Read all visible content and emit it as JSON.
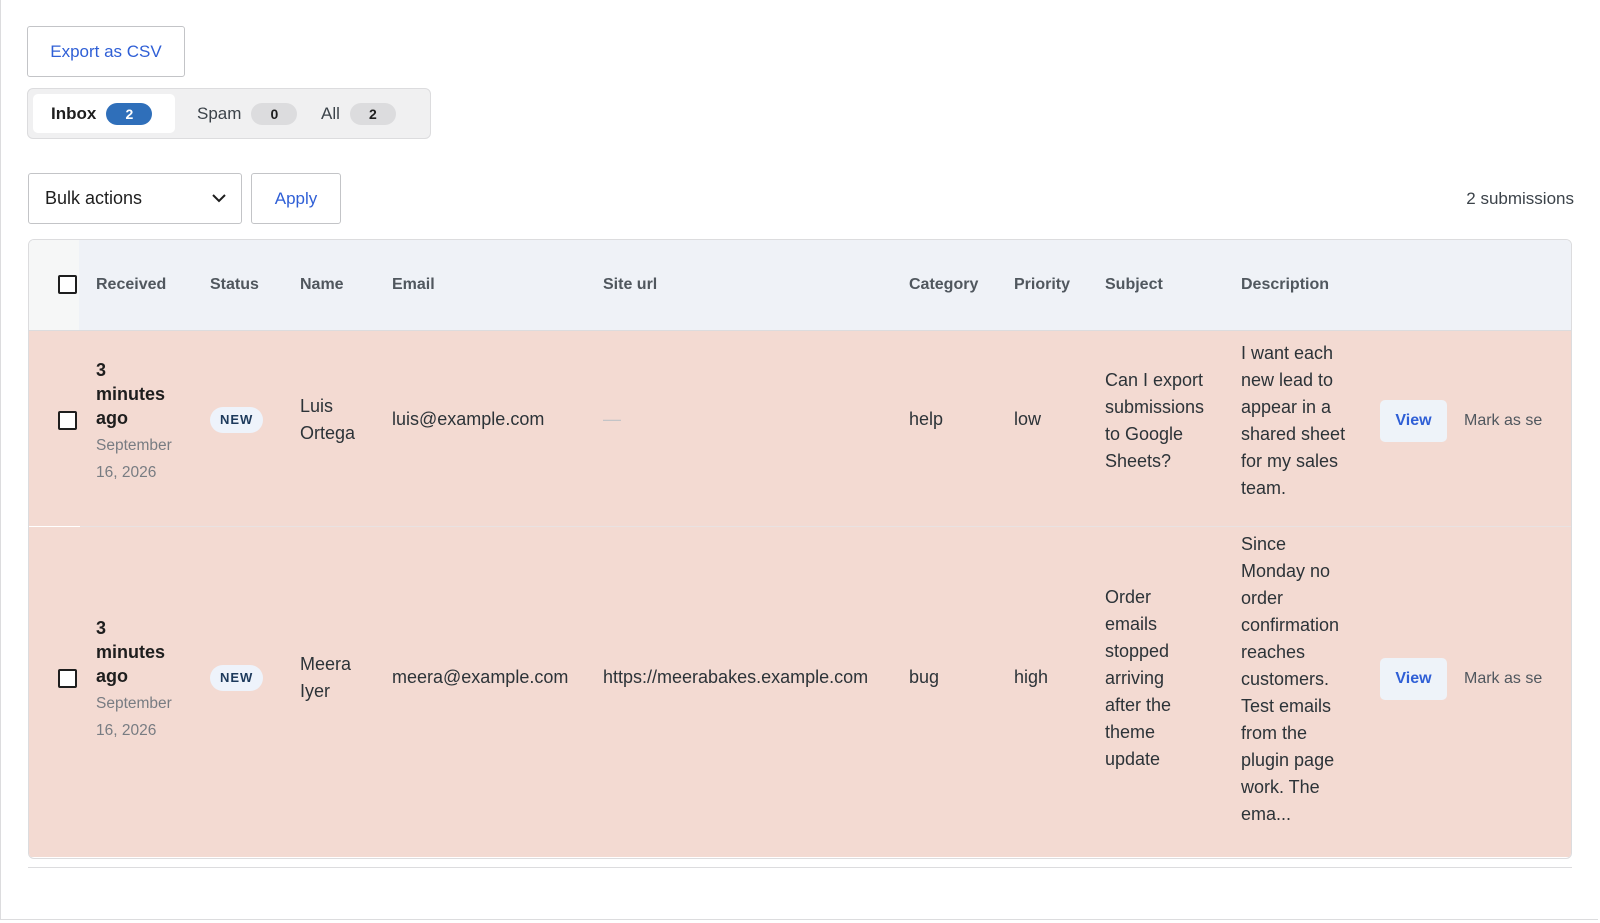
{
  "toolbar": {
    "export_label": "Export as CSV"
  },
  "tabs": [
    {
      "label": "Inbox",
      "count": "2",
      "active": true
    },
    {
      "label": "Spam",
      "count": "0",
      "active": false
    },
    {
      "label": "All",
      "count": "2",
      "active": false
    }
  ],
  "bulk": {
    "selected": "Bulk actions",
    "apply_label": "Apply"
  },
  "submissions_count": "2 submissions",
  "table": {
    "headers": [
      "Received",
      "Status",
      "Name",
      "Email",
      "Site url",
      "Category",
      "Priority",
      "Subject",
      "Description"
    ],
    "rows": [
      {
        "received_rel": "3 minutes ago",
        "received_date": "September 16, 2026",
        "status": "NEW",
        "name": "Luis Ortega",
        "email": "luis@example.com",
        "site_url": "—",
        "category": "help",
        "priority": "low",
        "subject": "Can I export submissions to Google Sheets?",
        "description": "I want each new lead to appear in a shared sheet for my sales team.",
        "view_label": "View",
        "mark_label": "Mark as se"
      },
      {
        "received_rel": "3 minutes ago",
        "received_date": "September 16, 2026",
        "status": "NEW",
        "name": "Meera Iyer",
        "email": "meera@example.com",
        "site_url": "https://meerabakes.example.com",
        "category": "bug",
        "priority": "high",
        "subject": "Order emails stopped arriving after the theme update",
        "description": "Since Monday no order confirmation reaches customers. Test emails from the plugin page work. The ema...",
        "view_label": "View",
        "mark_label": "Mark as se"
      }
    ]
  },
  "colors": {
    "row_highlight": "#f3dad2",
    "accent": "#2f5fd6",
    "badge_active": "#2f6fba"
  },
  "icons": {
    "select_chevron": "chevron-down-icon"
  }
}
